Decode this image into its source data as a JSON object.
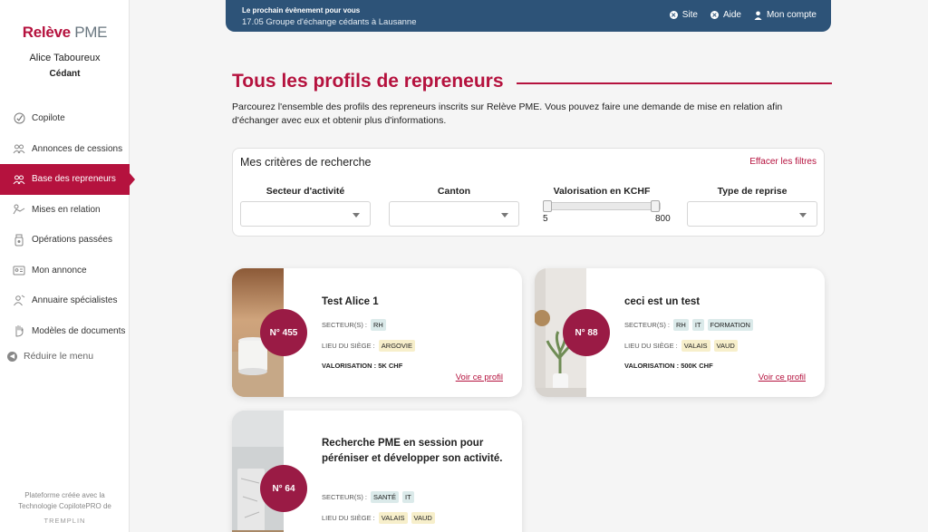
{
  "sidebar": {
    "logo_a": "Relève",
    "logo_b": "PME",
    "user_name": "Alice Taboureux",
    "user_role": "Cédant",
    "items": [
      {
        "label": "Copilote",
        "icon": "check-circle-icon"
      },
      {
        "label": "Annonces de cessions",
        "icon": "people-icon"
      },
      {
        "label": "Base des repreneurs",
        "icon": "group-icon",
        "active": true
      },
      {
        "label": "Mises en relation",
        "icon": "handshake-icon"
      },
      {
        "label": "Opérations passées",
        "icon": "jar-icon"
      },
      {
        "label": "Mon annonce",
        "icon": "card-icon"
      },
      {
        "label": "Annuaire spécialistes",
        "icon": "specialist-icon"
      },
      {
        "label": "Modèles de documents",
        "icon": "hand-icon"
      }
    ],
    "reduce": "Réduire le menu",
    "footer_line1": "Plateforme créée avec la",
    "footer_line2": "Technologie CopilotePRO de",
    "footer_brand": "TREMPLIN"
  },
  "banner": {
    "title": "Le prochain évènement pour vous",
    "event": "17.05 Groupe d'échange cédants à Lausanne",
    "links": [
      "Site",
      "Aide",
      "Mon compte"
    ]
  },
  "page": {
    "title": "Tous les profils de repreneurs",
    "intro": "Parcourez l'ensemble des profils des repreneurs inscrits sur Relève PME. Vous pouvez faire une demande de mise en relation afin d'échanger avec eux et obtenir plus d'informations."
  },
  "filters": {
    "heading": "Mes critères de recherche",
    "clear": "Effacer les filtres",
    "sector": "Secteur d'activité",
    "canton": "Canton",
    "valuation": "Valorisation en KCHF",
    "valuation_min": "5",
    "valuation_max": "800",
    "type": "Type de reprise"
  },
  "cards": [
    {
      "number": "N° 455",
      "title": "Test Alice 1",
      "sector_label": "SECTEUR(S) :",
      "sectors": [
        "RH"
      ],
      "location_label": "LIEU DU SIÈGE :",
      "locations": [
        "ARGOVIE"
      ],
      "valuation": "VALORISATION : 5K CHF",
      "link": "Voir ce profil"
    },
    {
      "number": "N° 88",
      "title": "ceci est un test",
      "sector_label": "SECTEUR(S) :",
      "sectors": [
        "RH",
        "IT",
        "FORMATION"
      ],
      "location_label": "LIEU DU SIÈGE :",
      "locations": [
        "VALAIS",
        "VAUD"
      ],
      "valuation": "VALORISATION : 500K CHF",
      "link": "Voir ce profil"
    },
    {
      "number": "N° 64",
      "title": "Recherche PME en session pour péréniser et développer son activité.",
      "sector_label": "SECTEUR(S) :",
      "sectors": [
        "SANTÉ",
        "IT"
      ],
      "location_label": "LIEU DU SIÈGE :",
      "locations": [
        "VALAIS",
        "VAUD"
      ]
    }
  ],
  "colors": {
    "brand": "#b5123e",
    "banner": "#2d5378",
    "badge": "#9a1b45"
  }
}
